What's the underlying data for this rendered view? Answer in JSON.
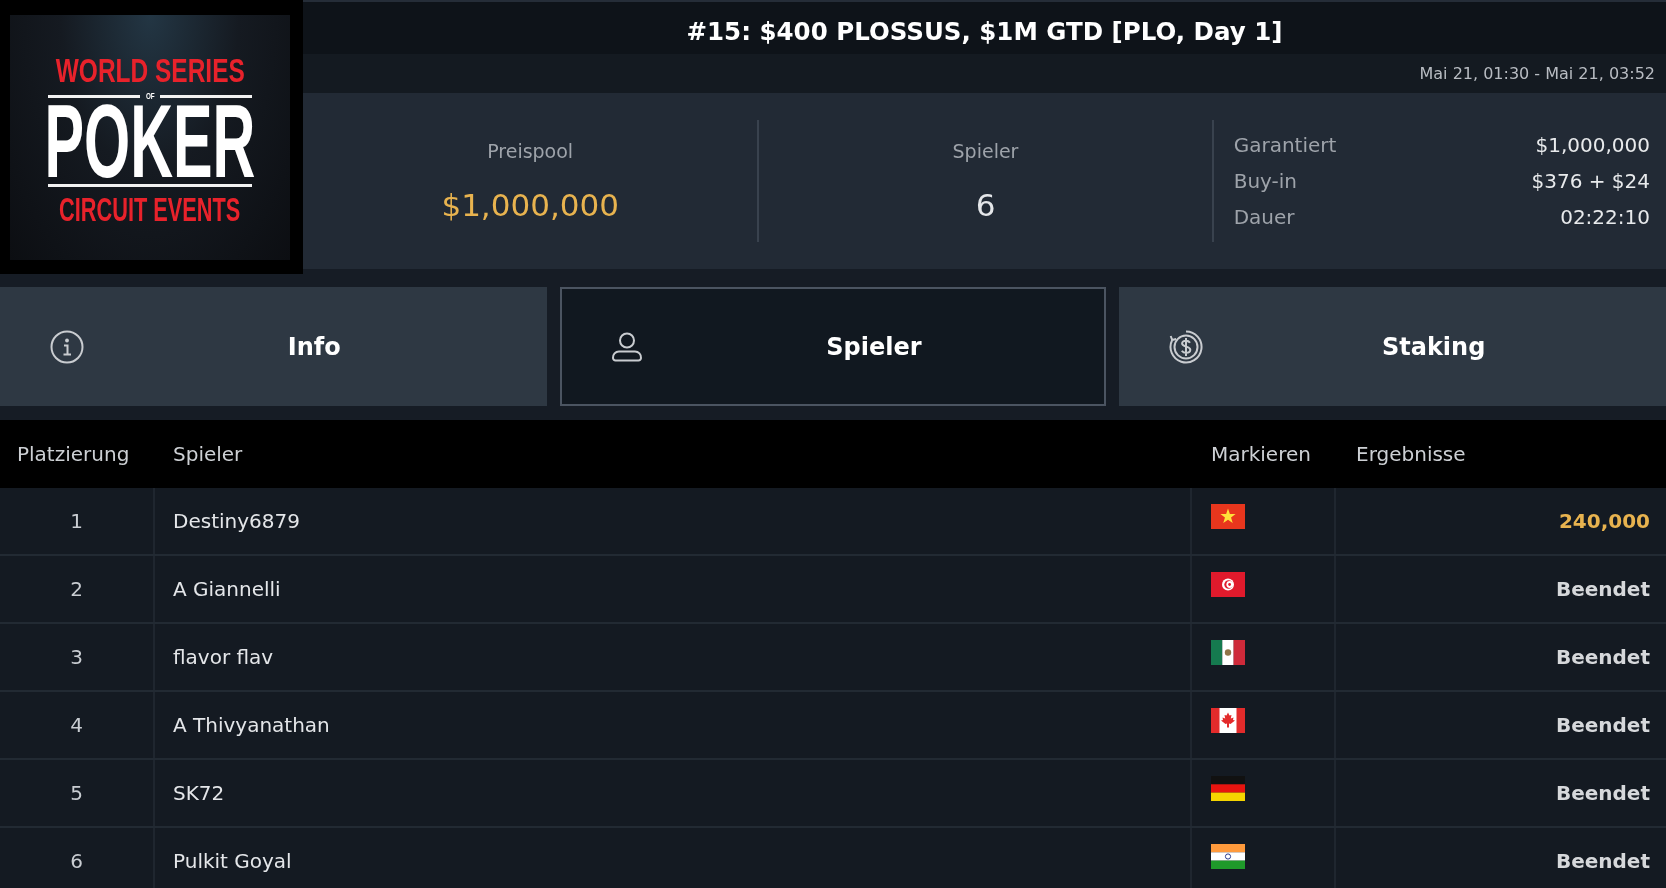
{
  "logo": {
    "top": "WORLD SERIES",
    "middle": "OF",
    "main": "POKER",
    "bottom": "CIRCUIT EVENTS"
  },
  "header": {
    "title": "#15: $400 PLOSSUS, $1M GTD [PLO, Day 1]",
    "schedule": "Mai 21, 01:30 - Mai 21, 03:52"
  },
  "stats": {
    "prize_pool": {
      "label": "Preispool",
      "value": "$1,000,000"
    },
    "players": {
      "label": "Spieler",
      "value": "6"
    },
    "details": [
      {
        "label": "Garantiert",
        "value": "$1,000,000"
      },
      {
        "label": "Buy-in",
        "value": "$376 + $24"
      },
      {
        "label": "Dauer",
        "value": "02:22:10"
      }
    ]
  },
  "tabs": [
    {
      "label": "Info",
      "kind": "info",
      "selected": false
    },
    {
      "label": "Spieler",
      "kind": "user",
      "selected": true
    },
    {
      "label": "Staking",
      "kind": "dollar",
      "selected": false
    }
  ],
  "table": {
    "columns": [
      "Platzierung",
      "Spieler",
      "Markieren",
      "Ergebnisse"
    ],
    "rows": [
      {
        "rank": "1",
        "player": "Destiny6879",
        "flag": {
          "kind": "vn"
        },
        "result": {
          "text": "240,000",
          "kind": "prize"
        }
      },
      {
        "rank": "2",
        "player": "A Giannelli",
        "flag": {
          "kind": "tn"
        },
        "result": {
          "text": "Beendet",
          "kind": "status"
        }
      },
      {
        "rank": "3",
        "player": "flavor flav",
        "flag": {
          "kind": "mx"
        },
        "result": {
          "text": "Beendet",
          "kind": "status"
        }
      },
      {
        "rank": "4",
        "player": "A Thivyanathan",
        "flag": {
          "kind": "ca"
        },
        "result": {
          "text": "Beendet",
          "kind": "status"
        }
      },
      {
        "rank": "5",
        "player": "SK72",
        "flag": {
          "kind": "de"
        },
        "result": {
          "text": "Beendet",
          "kind": "status"
        }
      },
      {
        "rank": "6",
        "player": "Pulkit Goyal",
        "flag": {
          "kind": "in"
        },
        "result": {
          "text": "Beendet",
          "kind": "status"
        }
      }
    ]
  }
}
